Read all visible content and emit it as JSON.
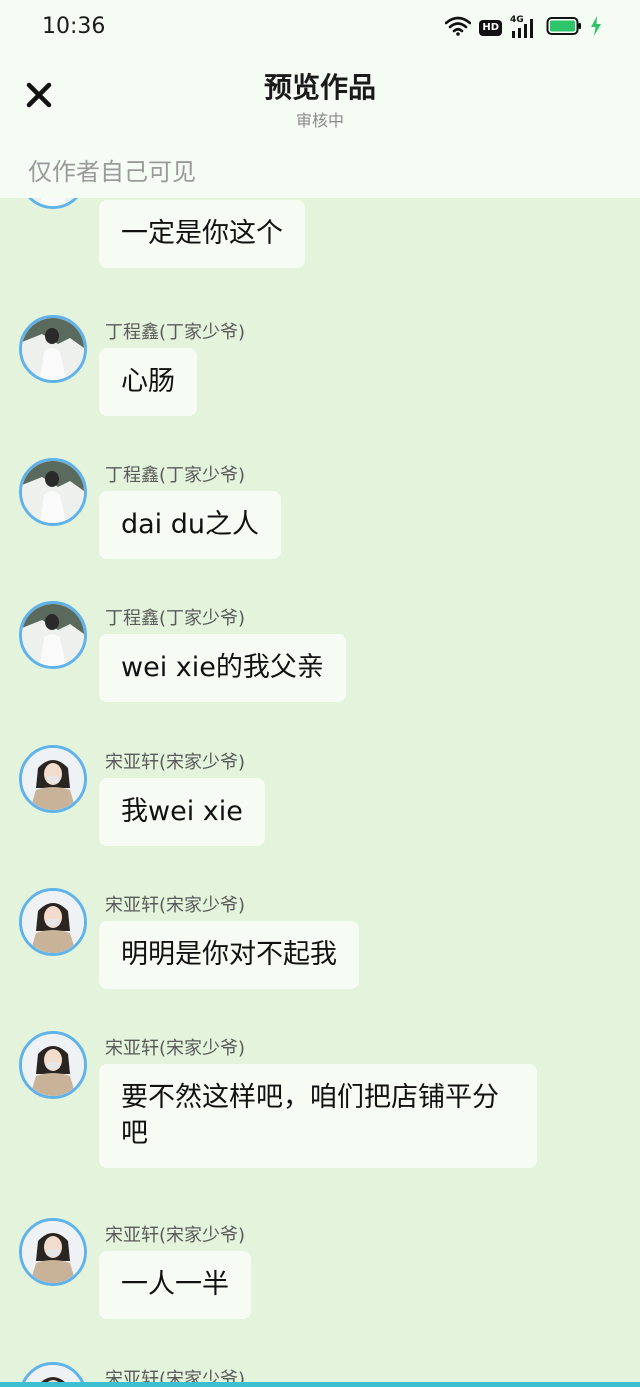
{
  "status_bar": {
    "time": "10:36",
    "hd_label": "HD",
    "network_label": "4G",
    "icons": [
      "wifi-icon",
      "hd-icon",
      "signal-icon",
      "battery-icon",
      "charging-icon"
    ],
    "battery_color": "#2ec46a"
  },
  "header": {
    "close_icon": "close-icon",
    "title": "预览作品",
    "subtitle": "审核中",
    "visibility_note": "仅作者自己可见"
  },
  "messages": [
    {
      "sender": "",
      "avatar": "avatar-ding",
      "text": "一定是你这个"
    },
    {
      "sender": "丁程鑫(丁家少爷)",
      "avatar": "avatar-ding",
      "text": "心肠"
    },
    {
      "sender": "丁程鑫(丁家少爷)",
      "avatar": "avatar-ding",
      "text": "dai du之人"
    },
    {
      "sender": "丁程鑫(丁家少爷)",
      "avatar": "avatar-ding",
      "text": "wei xie的我父亲"
    },
    {
      "sender": "宋亚轩(宋家少爷)",
      "avatar": "avatar-song",
      "text": "我wei xie"
    },
    {
      "sender": "宋亚轩(宋家少爷)",
      "avatar": "avatar-song",
      "text": "明明是你对不起我"
    },
    {
      "sender": "宋亚轩(宋家少爷)",
      "avatar": "avatar-song",
      "text": "要不然这样吧，咱们把店铺平分吧"
    },
    {
      "sender": "宋亚轩(宋家少爷)",
      "avatar": "avatar-song",
      "text": "一人一半"
    },
    {
      "sender": "宋亚轩(宋家少爷)",
      "avatar": "avatar-song",
      "text": ""
    }
  ],
  "colors": {
    "chat_background": "#e4f4dc",
    "bubble_background": "#f6fcf4",
    "avatar_ring": "#5fb2ea",
    "bottom_accent": "#3bbfd1"
  }
}
